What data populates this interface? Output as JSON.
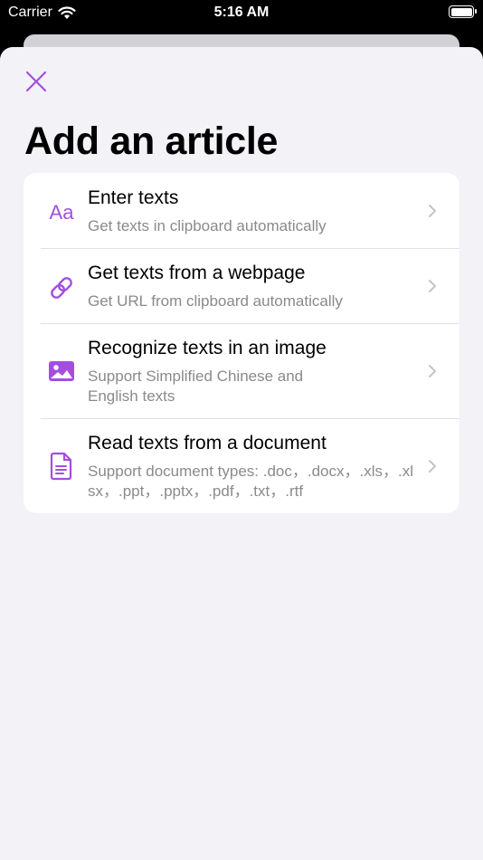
{
  "status_bar": {
    "carrier": "Carrier",
    "time": "5:16 AM"
  },
  "sheet": {
    "title": "Add an article",
    "accent_color": "#a34ee0",
    "items": [
      {
        "icon": "text-size-icon",
        "icon_text": "Aa",
        "title": "Enter texts",
        "subtitle": "Get texts in clipboard automatically"
      },
      {
        "icon": "link-icon",
        "title": "Get texts from a webpage",
        "subtitle": "Get URL from clipboard automatically"
      },
      {
        "icon": "photo-icon",
        "title": "Recognize texts in an image",
        "subtitle": "Support Simplified Chinese and English texts"
      },
      {
        "icon": "document-icon",
        "title": "Read texts from a document",
        "subtitle": "Support document types: .doc，.docx，.xls，.xlsx，.ppt，.pptx，.pdf，.txt，.rtf"
      }
    ]
  }
}
